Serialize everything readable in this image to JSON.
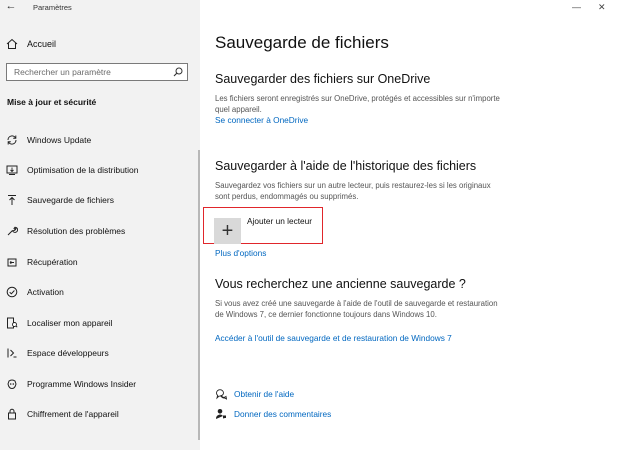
{
  "window": {
    "title": "Paramètres",
    "back_glyph": "←",
    "minimize_glyph": "—",
    "close_glyph": "✕"
  },
  "sidebar": {
    "home_label": "Accueil",
    "search_placeholder": "Rechercher un paramètre",
    "section_title": "Mise à jour et sécurité",
    "items": [
      {
        "label": "Windows Update",
        "icon": "sync-icon"
      },
      {
        "label": "Optimisation de la distribution",
        "icon": "delivery-optimization-icon"
      },
      {
        "label": "Sauvegarde de fichiers",
        "icon": "backup-arrow-icon"
      },
      {
        "label": "Résolution des problèmes",
        "icon": "wrench-icon"
      },
      {
        "label": "Récupération",
        "icon": "recovery-icon"
      },
      {
        "label": "Activation",
        "icon": "check-circle-icon"
      },
      {
        "label": "Localiser mon appareil",
        "icon": "find-device-icon"
      },
      {
        "label": "Espace développeurs",
        "icon": "developer-icon"
      },
      {
        "label": "Programme Windows Insider",
        "icon": "insider-icon"
      },
      {
        "label": "Chiffrement de l'appareil",
        "icon": "lock-icon"
      }
    ]
  },
  "main": {
    "title": "Sauvegarde de fichiers",
    "onedrive": {
      "heading": "Sauvegarder des fichiers sur OneDrive",
      "description": "Les fichiers seront enregistrés sur OneDrive, protégés et accessibles sur n'importe quel appareil.",
      "link": "Se connecter à OneDrive"
    },
    "history": {
      "heading": "Sauvegarder à l'aide de l'historique des fichiers",
      "description": "Sauvegardez vos fichiers sur un autre lecteur, puis restaurez-les si les originaux sont perdus, endommagés ou supprimés.",
      "add_drive_label": "Ajouter un lecteur",
      "add_glyph": "+",
      "more_options": "Plus d'options"
    },
    "older": {
      "heading": "Vous recherchez une ancienne sauvegarde ?",
      "description": "Si vous avez créé une sauvegarde à l'aide de l'outil de sauvegarde et restauration de Windows 7, ce dernier fonctionne toujours dans Windows 10.",
      "link": "Accéder à l'outil de sauvegarde et de restauration de Windows 7"
    },
    "help": {
      "get_help": "Obtenir de l'aide",
      "feedback": "Donner des commentaires"
    }
  },
  "colors": {
    "sidebar_bg": "#f2f2f2",
    "link": "#0067c0",
    "highlight": "#e0262b"
  }
}
